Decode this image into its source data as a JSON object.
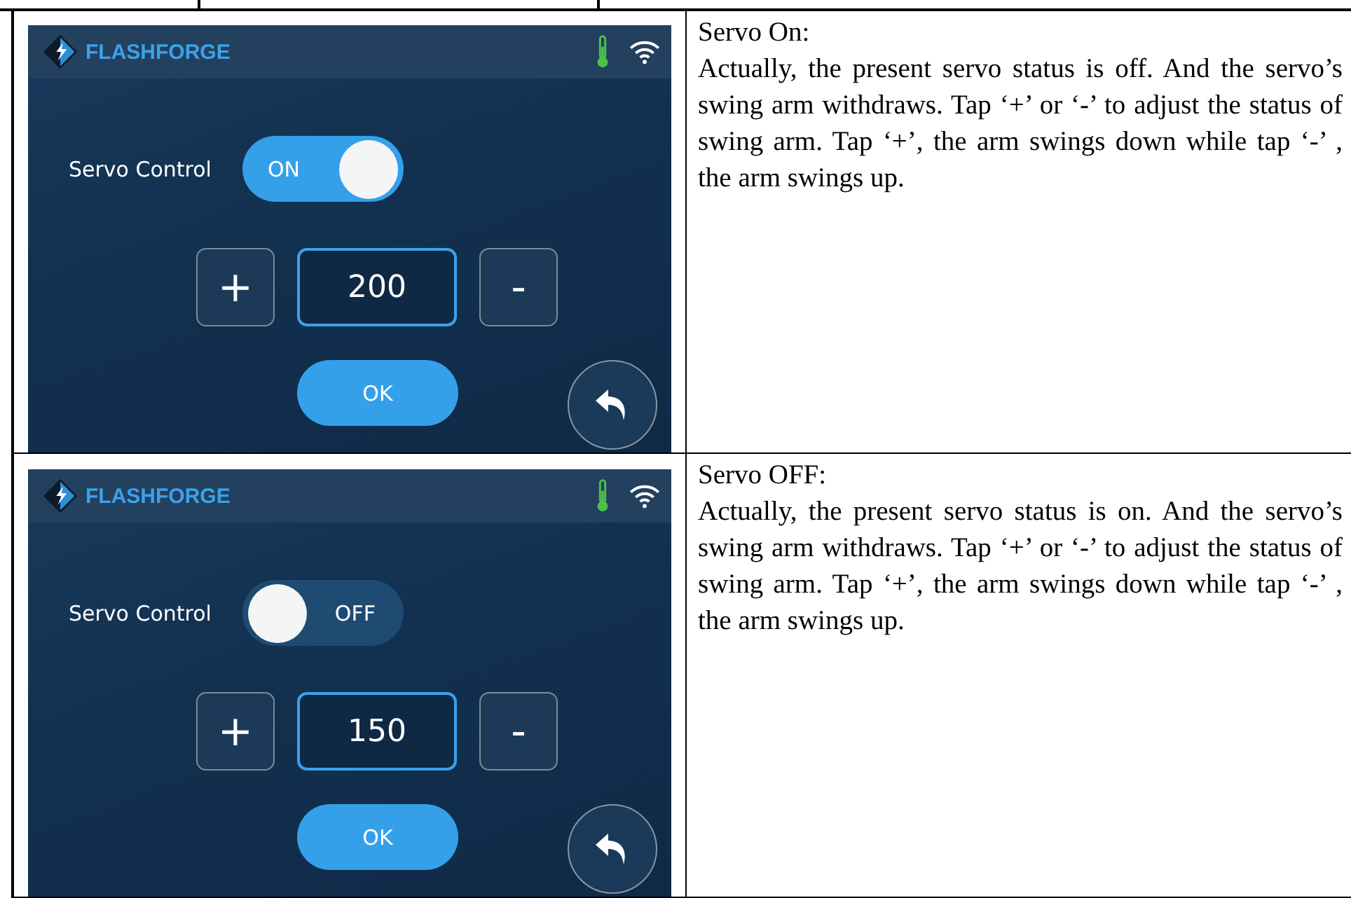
{
  "rows": [
    {
      "screen": {
        "brand": "FLASHFORGE",
        "servo_label": "Servo Control",
        "toggle": {
          "label": "ON",
          "on": true
        },
        "plus": "+",
        "value": "200",
        "minus": "-",
        "ok": "OK"
      },
      "heading": "Servo On:",
      "description": "Actually, the present servo status is off. And the servo’s swing arm withdraws. Tap ‘+’ or ‘-’ to adjust the status of swing arm. Tap ‘+’, the arm swings down while tap ‘-’ , the arm swings up."
    },
    {
      "screen": {
        "brand": "FLASHFORGE",
        "servo_label": "Servo Control",
        "toggle": {
          "label": "OFF",
          "on": false
        },
        "plus": "+",
        "value": "150",
        "minus": "-",
        "ok": "OK"
      },
      "heading": "Servo OFF:",
      "description": "Actually, the present servo status is on. And the servo’s swing arm withdraws. Tap ‘+’ or ‘-’ to adjust the status of swing arm. Tap ‘+’, the arm swings down while tap ‘-’ , the arm swings up."
    }
  ]
}
